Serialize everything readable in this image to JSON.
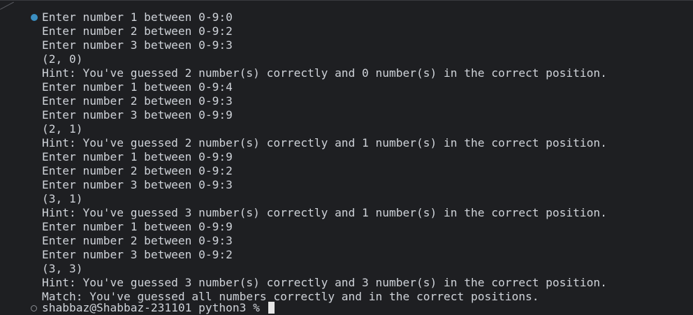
{
  "terminal": {
    "lines": [
      "Enter number 1 between 0-9:0",
      "Enter number 2 between 0-9:2",
      "Enter number 3 between 0-9:3",
      "(2, 0)",
      "Hint: You've guessed 2 number(s) correctly and 0 number(s) in the correct position.",
      "Enter number 1 between 0-9:4",
      "Enter number 2 between 0-9:3",
      "Enter number 3 between 0-9:9",
      "(2, 1)",
      "Hint: You've guessed 2 number(s) correctly and 1 number(s) in the correct position.",
      "Enter number 1 between 0-9:9",
      "Enter number 2 between 0-9:2",
      "Enter number 3 between 0-9:3",
      "(3, 1)",
      "Hint: You've guessed 3 number(s) correctly and 1 number(s) in the correct position.",
      "Enter number 1 between 0-9:9",
      "Enter number 2 between 0-9:3",
      "Enter number 3 between 0-9:2",
      "(3, 3)",
      "Hint: You've guessed 3 number(s) correctly and 3 number(s) in the correct position.",
      "Match: You've guessed all numbers correctly and in the correct positions."
    ],
    "prompt": "shabbaz@Shabbaz-231101 python3 % "
  },
  "colors": {
    "background": "#1e1f22",
    "text": "#cfd3d9",
    "run-indicator": "#3b8fc2"
  }
}
